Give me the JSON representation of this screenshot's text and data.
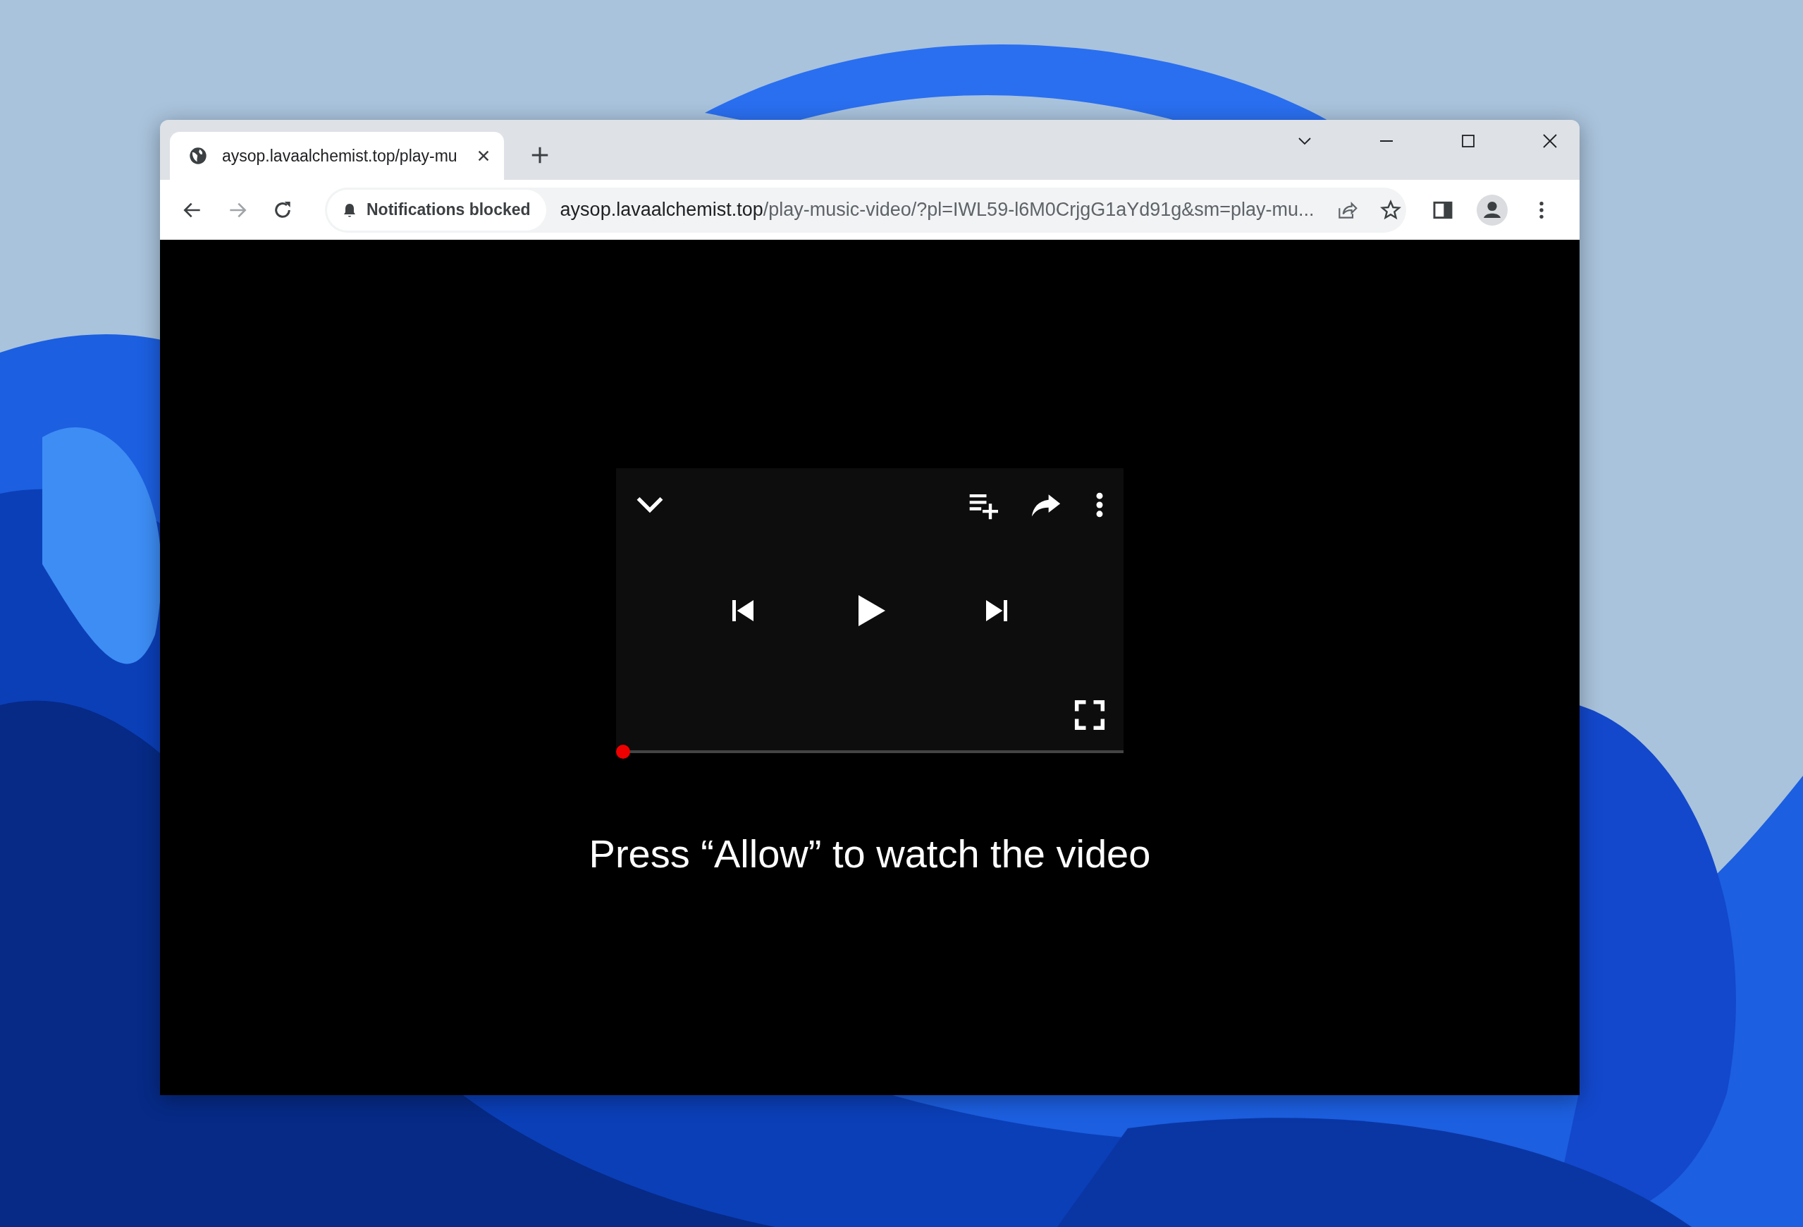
{
  "browser": {
    "tabs": [
      {
        "title": "aysop.lavaalchemist.top/play-mu",
        "selected": true
      }
    ],
    "address_bar": {
      "permission_chip": "Notifications blocked",
      "host": "aysop.lavaalchemist.top",
      "path": "/play-music-video/?pl=IWL59-l6M0CrjgG1aYd91g&sm=play-mu..."
    },
    "forward_disabled": true
  },
  "player": {
    "progress": {
      "level": 0
    }
  },
  "caption": "Press “Allow” to watch the video"
}
